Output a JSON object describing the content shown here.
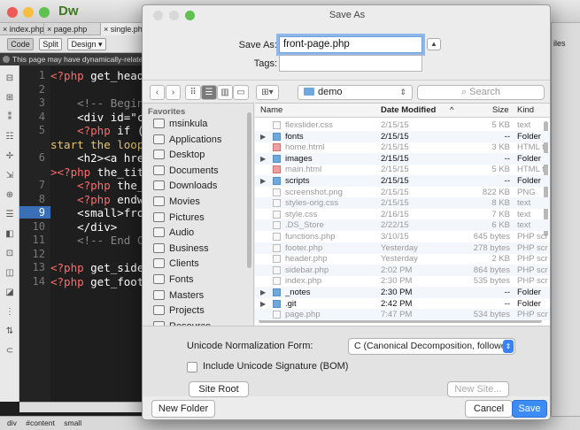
{
  "dw": {
    "app_logo": "Dw",
    "tabs": [
      "index.php",
      "page.php",
      "single.php"
    ],
    "toolbar": {
      "code": "Code",
      "split": "Split",
      "design": "Design"
    },
    "notice": "This page may have dynamically-related files",
    "right_panel_label": "iles",
    "line_numbers": [
      "1",
      "2",
      "3",
      "4",
      "5",
      "",
      "6",
      "",
      "7",
      "8",
      "9",
      "10",
      "11",
      "12",
      "13",
      "14"
    ],
    "active_line": "9",
    "code_lines": [
      {
        "parts": [
          {
            "t": "<?php ",
            "c": "kw"
          },
          {
            "t": "get_heade",
            "c": ""
          }
        ]
      },
      {
        "parts": []
      },
      {
        "parts": [
          {
            "t": "    <!-- Begin",
            "c": "cm"
          }
        ]
      },
      {
        "parts": [
          {
            "t": "    <div id=\"co",
            "c": ""
          }
        ]
      },
      {
        "parts": [
          {
            "t": "    <?php ",
            "c": "kw"
          },
          {
            "t": "if (",
            "c": ""
          }
        ]
      },
      {
        "parts": [
          {
            "t": "start the loop",
            "c": "str"
          }
        ]
      },
      {
        "parts": [
          {
            "t": "    <h2><a href",
            "c": ""
          }
        ]
      },
      {
        "parts": [
          {
            "t": "><?php ",
            "c": "kw"
          },
          {
            "t": "the_titl",
            "c": ""
          }
        ]
      },
      {
        "parts": [
          {
            "t": "    <?php ",
            "c": "kw"
          },
          {
            "t": "the_c",
            "c": ""
          }
        ]
      },
      {
        "parts": [
          {
            "t": "    <?php ",
            "c": "kw"
          },
          {
            "t": "endwh",
            "c": ""
          }
        ]
      },
      {
        "parts": [
          {
            "t": "    <small>fron",
            "c": ""
          }
        ]
      },
      {
        "parts": [
          {
            "t": "    </div>",
            "c": ""
          }
        ]
      },
      {
        "parts": [
          {
            "t": "    <!-- End Co",
            "c": "cm"
          }
        ]
      },
      {
        "parts": []
      },
      {
        "parts": [
          {
            "t": "<?php ",
            "c": "kw"
          },
          {
            "t": "get_sideb",
            "c": ""
          }
        ]
      },
      {
        "parts": [
          {
            "t": "<?php ",
            "c": "kw"
          },
          {
            "t": "get_foote",
            "c": ""
          }
        ]
      }
    ],
    "status_tags": [
      "div",
      "#content",
      "small"
    ]
  },
  "dialog": {
    "title": "Save As",
    "save_as_label": "Save As:",
    "save_as_value": "front-page.php",
    "tags_label": "Tags:",
    "tags_value": "",
    "current_folder": "demo",
    "search_placeholder": "Search",
    "sidebar_heading": "Favorites",
    "sidebar_items": [
      "msinkula",
      "Applications",
      "Desktop",
      "Documents",
      "Downloads",
      "Movies",
      "Pictures",
      "Audio",
      "Business",
      "Clients",
      "Fonts",
      "Masters",
      "Projects",
      "Resource"
    ],
    "columns": {
      "name": "Name",
      "date": "Date Modified",
      "size": "Size",
      "kind": "Kind"
    },
    "files": [
      {
        "name": "flexslider.css",
        "date": "2/15/15",
        "size": "5 KB",
        "kind": "text",
        "folder": false
      },
      {
        "name": "fonts",
        "date": "2/15/15",
        "size": "--",
        "kind": "Folder",
        "folder": true
      },
      {
        "name": "home.html",
        "date": "2/15/15",
        "size": "3 KB",
        "kind": "HTML t",
        "folder": false
      },
      {
        "name": "images",
        "date": "2/15/15",
        "size": "--",
        "kind": "Folder",
        "folder": true
      },
      {
        "name": "main.html",
        "date": "2/15/15",
        "size": "5 KB",
        "kind": "HTML t",
        "folder": false
      },
      {
        "name": "scripts",
        "date": "2/15/15",
        "size": "--",
        "kind": "Folder",
        "folder": true
      },
      {
        "name": "screenshot.png",
        "date": "2/15/15",
        "size": "822 KB",
        "kind": "PNG",
        "folder": false
      },
      {
        "name": "styles-orig.css",
        "date": "2/15/15",
        "size": "8 KB",
        "kind": "text",
        "folder": false
      },
      {
        "name": "style.css",
        "date": "2/16/15",
        "size": "7 KB",
        "kind": "text",
        "folder": false
      },
      {
        "name": ".DS_Store",
        "date": "2/22/15",
        "size": "6 KB",
        "kind": "text",
        "folder": false
      },
      {
        "name": "functions.php",
        "date": "3/10/15",
        "size": "645 bytes",
        "kind": "PHP scr",
        "folder": false
      },
      {
        "name": "footer.php",
        "date": "Yesterday",
        "size": "278 bytes",
        "kind": "PHP scr",
        "folder": false
      },
      {
        "name": "header.php",
        "date": "Yesterday",
        "size": "2 KB",
        "kind": "PHP scr",
        "folder": false
      },
      {
        "name": "sidebar.php",
        "date": "2:02 PM",
        "size": "864 bytes",
        "kind": "PHP scr",
        "folder": false
      },
      {
        "name": "index.php",
        "date": "2:30 PM",
        "size": "535 bytes",
        "kind": "PHP scr",
        "folder": false
      },
      {
        "name": "_notes",
        "date": "2:30 PM",
        "size": "--",
        "kind": "Folder",
        "folder": true
      },
      {
        "name": ".git",
        "date": "2:42 PM",
        "size": "--",
        "kind": "Folder",
        "folder": true
      },
      {
        "name": "page.php",
        "date": "7:47 PM",
        "size": "534 bytes",
        "kind": "PHP scr",
        "folder": false
      }
    ],
    "unicode_label": "Unicode Normalization Form:",
    "unicode_value": "C (Canonical Decomposition, followed by Canonical Com...",
    "bom_label": "Include Unicode Signature (BOM)",
    "site_root": "Site Root",
    "new_site": "New Site...",
    "new_folder": "New Folder",
    "cancel": "Cancel",
    "save": "Save"
  },
  "colors": {
    "accent": "#3d8cf6",
    "code_bg": "#1e1e1e",
    "keyword": "#ff6b6b",
    "comment": "#888888",
    "active_line": "#3a6fb7"
  }
}
